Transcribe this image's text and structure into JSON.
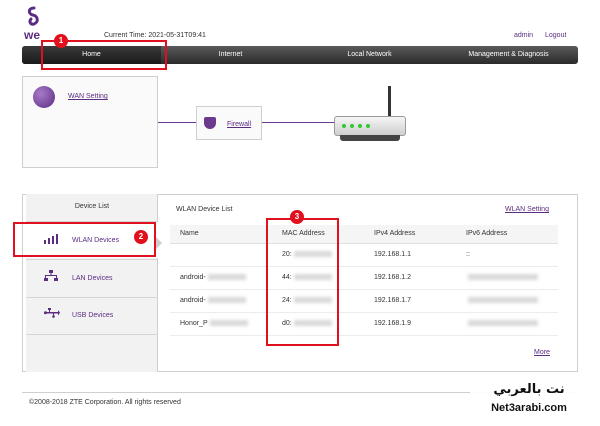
{
  "header": {
    "logo_text": "we",
    "current_time": "Current Time: 2021-05-31T09:41",
    "user": "admin",
    "logout": "Logout"
  },
  "nav": {
    "home": "Home",
    "internet": "Internet",
    "local_network": "Local Network",
    "management": "Management & Diagnosis"
  },
  "topology": {
    "wan_setting": "WAN Setting",
    "firewall": "Firewall"
  },
  "device_list": {
    "title": "Device List",
    "items": [
      {
        "label": "WLAN Devices"
      },
      {
        "label": "LAN Devices"
      },
      {
        "label": "USB Devices"
      }
    ]
  },
  "wlan_list": {
    "title": "WLAN Device List",
    "settings_link": "WLAN Setting",
    "columns": [
      "Name",
      "MAC Address",
      "IPv4 Address",
      "IPv6 Address"
    ],
    "rows": [
      {
        "name": "",
        "mac": "20:",
        "ipv4": "192.168.1.1",
        "ipv6": "::"
      },
      {
        "name": "android-",
        "mac": "44:",
        "ipv4": "192.168.1.2",
        "ipv6": ""
      },
      {
        "name": "android-",
        "mac": "24:",
        "ipv4": "192.168.1.7",
        "ipv6": ""
      },
      {
        "name": "Honor_P",
        "mac": "d0:",
        "ipv4": "192.168.1.9",
        "ipv6": ""
      }
    ],
    "more": "More"
  },
  "annotations": {
    "badge1": "1",
    "badge2": "2",
    "badge3": "3"
  },
  "footer": {
    "copyright": "©2008-2018 ZTE Corporation. All rights reserved"
  },
  "watermark": {
    "arabic": "نت بالعربي",
    "latin": "Net3arabi.com"
  },
  "colors": {
    "brand": "#5a2d82",
    "annotation": "#e0111d",
    "nav_bg": "#2a2a2a"
  }
}
